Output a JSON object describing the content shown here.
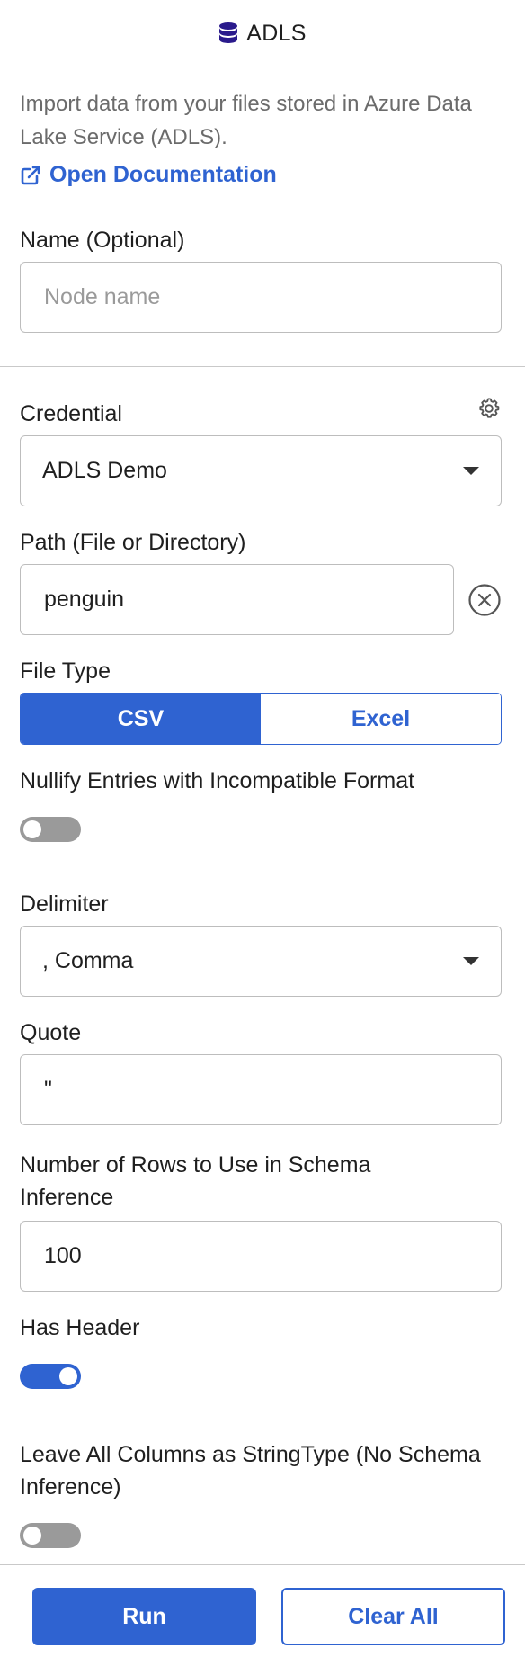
{
  "header": {
    "title": "ADLS",
    "icon": "database-icon"
  },
  "intro": {
    "description": "Import data from your files stored in Azure Data Lake Service (ADLS).",
    "doc_link_label": "Open Documentation",
    "doc_link_icon": "external-link-icon"
  },
  "name_field": {
    "label": "Name (Optional)",
    "placeholder": "Node name",
    "value": ""
  },
  "credential": {
    "label": "Credential",
    "selected": "ADLS Demo",
    "settings_icon": "gear-icon"
  },
  "path": {
    "label": "Path (File or Directory)",
    "value": "penguin",
    "clear_icon": "clear-circle-icon"
  },
  "file_type": {
    "label": "File Type",
    "options": [
      "CSV",
      "Excel"
    ],
    "selected": "CSV"
  },
  "nullify": {
    "label": "Nullify Entries with Incompatible Format",
    "enabled": false
  },
  "delimiter": {
    "label": "Delimiter",
    "selected": ", Comma"
  },
  "quote": {
    "label": "Quote",
    "value": "\""
  },
  "schema_rows": {
    "label": "Number of Rows to Use in Schema Inference",
    "value": "100"
  },
  "has_header": {
    "label": "Has Header",
    "enabled": true
  },
  "string_type": {
    "label": "Leave All Columns as StringType (No Schema Inference)",
    "enabled": false
  },
  "footer": {
    "run_label": "Run",
    "clear_label": "Clear All"
  },
  "colors": {
    "accent": "#2f63d1",
    "icon_purple": "#2a1a8c",
    "toggle_off": "#9a9a9a"
  }
}
